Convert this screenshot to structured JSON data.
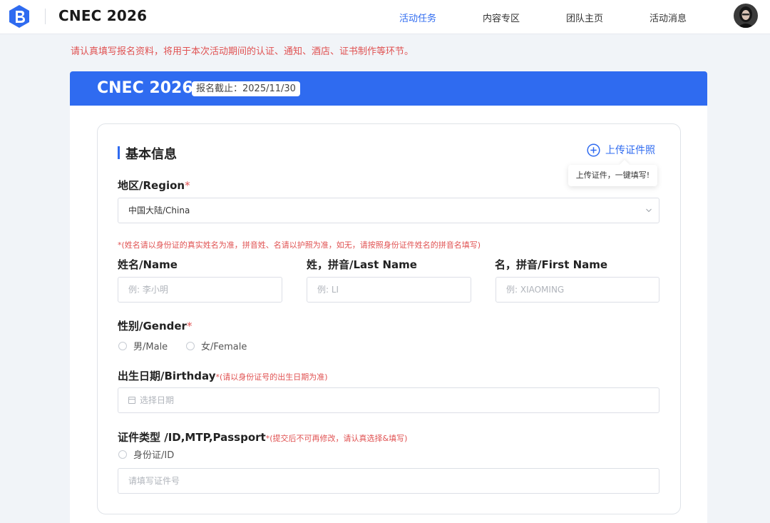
{
  "header": {
    "app_title": "CNEC 2026",
    "nav": [
      "活动任务",
      "内容专区",
      "团队主页",
      "活动消息"
    ],
    "active_index": 0
  },
  "notice": "请认真填写报名资料，将用于本次活动期间的认证、通知、酒店、证书制作等环节。",
  "banner": {
    "title": "CNEC 2026",
    "deadline": "报名截止：2025/11/30"
  },
  "section": {
    "title": "基本信息",
    "upload_label": "上传证件照",
    "upload_tooltip": "上传证件，一键填写!"
  },
  "form": {
    "region": {
      "label": "地区/Region",
      "required": "*",
      "value": "中国大陆/China"
    },
    "name_hint": "*(姓名请以身份证的真实姓名为准，拼音姓、名请以护照为准，如无，请按照身份证件姓名的拼音名填写)",
    "name": {
      "label": "姓名/Name",
      "placeholder": "例:  李小明"
    },
    "last_name": {
      "label": "姓，拼音/Last Name",
      "placeholder": "例:  LI"
    },
    "first_name": {
      "label": "名，拼音/First Name",
      "placeholder": "例: XIAOMING"
    },
    "gender": {
      "label": "性别/Gender",
      "required": "*",
      "options": [
        "男/Male",
        "女/Female"
      ]
    },
    "birthday": {
      "label": "出生日期/Birthday",
      "hint": "*(请以身份证号的出生日期为准)",
      "placeholder": "选择日期"
    },
    "id_type": {
      "label": "证件类型 /ID,MTP,Passport",
      "hint": "*(提交后不可再修改，请认真选择&填写)",
      "options": [
        "身份证/ID"
      ],
      "placeholder": "请填写证件号"
    }
  },
  "colors": {
    "accent": "#2f6bf0",
    "warning": "#e05252"
  }
}
